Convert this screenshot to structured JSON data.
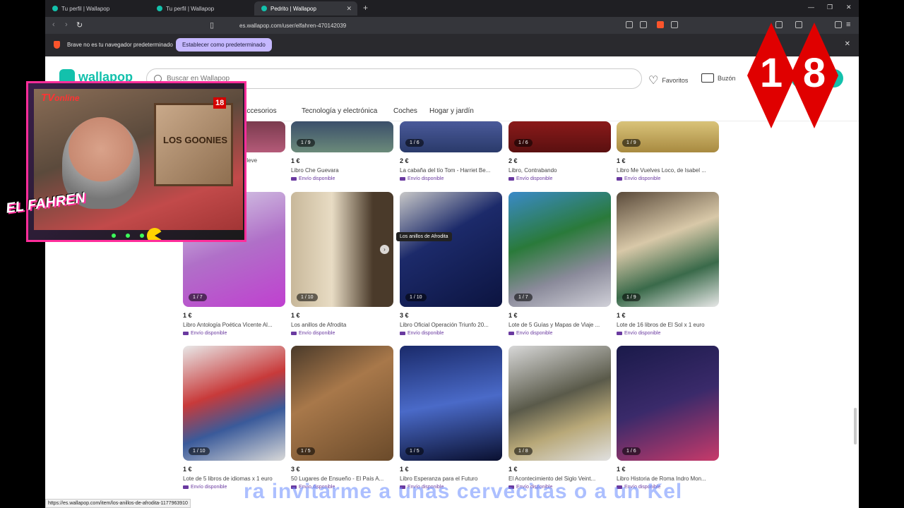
{
  "browser": {
    "tabs": [
      {
        "label": "Tu perfil | Wallapop",
        "active": false
      },
      {
        "label": "Tu perfil | Wallapop",
        "active": false
      },
      {
        "label": "Pedrito | Wallapop",
        "active": true
      }
    ],
    "url": "es.wallapop.com/user/elfahren-470142039",
    "infobar_message": "Brave no es tu navegador predeterminado",
    "infobar_button": "Establecer como predeterminado",
    "status_url": "https://es.wallapop.com/item/los-anillos-de-afrodita-1177963910"
  },
  "header": {
    "logo": "wallapop",
    "search_placeholder": "Buscar en Wallapop",
    "favorites": "Favoritos",
    "inbox": "Buzón",
    "categories": [
      "y accesorios",
      "Tecnología y electrónica",
      "Coches",
      "Hogar y jardín"
    ]
  },
  "shipping_label": "Envío disponible",
  "products_row1": [
    {
      "count": "",
      "price": "",
      "title": "n te lleve"
    },
    {
      "count": "1 / 9",
      "price": "1 €",
      "title": "Libro Che Guevara"
    },
    {
      "count": "1 / 6",
      "price": "2 €",
      "title": "La cabaña del tío Tom - Harriet Be..."
    },
    {
      "count": "1 / 6",
      "price": "2 €",
      "title": "Libro, Contrabando"
    },
    {
      "count": "1 / 9",
      "price": "1 €",
      "title": "Libro Me Vuelves Loco, de Isabel ..."
    }
  ],
  "products_row2": [
    {
      "count": "1 / 7",
      "price": "1 €",
      "title": "Libro Antología Poética Vicente Al..."
    },
    {
      "count": "1 / 10",
      "price": "1 €",
      "title": "Los anillos de Afrodita"
    },
    {
      "count": "1 / 10",
      "price": "3 €",
      "title": "Libro Oficial Operación Triunfo 20..."
    },
    {
      "count": "1 / 7",
      "price": "1 €",
      "title": "Lote de 5 Guías y Mapas de Viaje ..."
    },
    {
      "count": "1 / 9",
      "price": "1 €",
      "title": "Lote de 16 libros de El Sol x 1 euro"
    }
  ],
  "products_row3": [
    {
      "count": "1 / 10",
      "price": "1 €",
      "title": "Lote de 5 libros de idiomas x 1 euro"
    },
    {
      "count": "1 / 5",
      "price": "3 €",
      "title": "50 Lugares de Ensueño - El País A..."
    },
    {
      "count": "1 / 5",
      "price": "1 €",
      "title": "Libro Esperanza para el Futuro"
    },
    {
      "count": "1 / 8",
      "price": "1 €",
      "title": "El Acontecimiento del Siglo Veint..."
    },
    {
      "count": "1 / 6",
      "price": "1 €",
      "title": "Libro Historia de Roma Indro Mon..."
    }
  ],
  "tooltip": "Los anillos de Afrodita",
  "overlay": {
    "tv_logo": "TV",
    "tv_logo_suffix": "online",
    "mini_badge": "18",
    "poster_text": "LOS GOONIES",
    "streamer_name": "EL FAHREN",
    "badge_digit_1": "1",
    "badge_digit_2": "8",
    "caption": "ra invitarme a unas cervecitas o a un Kel"
  },
  "colors": {
    "brand": "#13c1ac",
    "shipping": "#6a3aa0",
    "badge": "#e00000"
  }
}
